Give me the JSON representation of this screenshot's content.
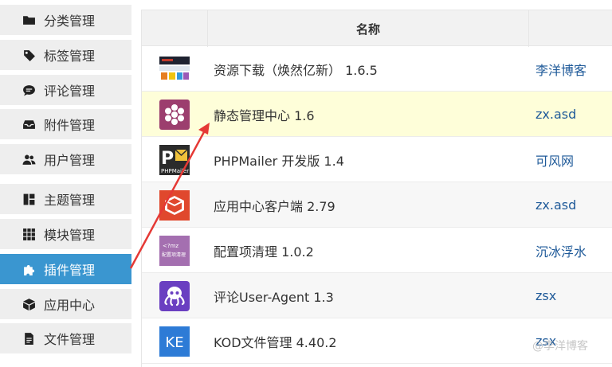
{
  "sidebar": {
    "items": [
      {
        "label": "分类管理",
        "icon": "folder-icon"
      },
      {
        "label": "标签管理",
        "icon": "tag-icon"
      },
      {
        "label": "评论管理",
        "icon": "comment-icon"
      },
      {
        "label": "附件管理",
        "icon": "inbox-icon"
      },
      {
        "label": "用户管理",
        "icon": "users-icon"
      },
      {
        "label": "主题管理",
        "icon": "layout-icon"
      },
      {
        "label": "模块管理",
        "icon": "grid-icon"
      },
      {
        "label": "插件管理",
        "icon": "puzzle-icon",
        "active": true
      },
      {
        "label": "应用中心",
        "icon": "cube-icon"
      },
      {
        "label": "文件管理",
        "icon": "file-icon"
      }
    ]
  },
  "table": {
    "header_name": "名称",
    "rows": [
      {
        "name": "资源下载（焕然亿新） 1.6.5",
        "author": "李洋博客",
        "icon": "resource-download-plugin-icon"
      },
      {
        "name": "静态管理中心 1.6",
        "author": "zx.asd",
        "icon": "static-manager-plugin-icon"
      },
      {
        "name": "PHPMailer 开发版 1.4",
        "author": "可风网",
        "icon": "phpmailer-plugin-icon"
      },
      {
        "name": "应用中心客户端 2.79",
        "author": "zx.asd",
        "icon": "app-center-client-plugin-icon"
      },
      {
        "name": "配置项清理 1.0.2",
        "author": "沉冰浮水",
        "icon": "config-cleanup-plugin-icon",
        "icon_text": "配置项清理"
      },
      {
        "name": "评论User-Agent 1.3",
        "author": "zsx",
        "icon": "octopus-plugin-icon"
      },
      {
        "name": "KOD文件管理 4.40.2",
        "author": "zsx",
        "icon": "kod-plugin-icon",
        "icon_text": "KE"
      }
    ]
  },
  "watermark": "@李洋博客",
  "colors": {
    "active": "#3a96d0",
    "highlight": "#fefed9",
    "author_link": "#1f5a99",
    "arrow": "#e53935"
  }
}
